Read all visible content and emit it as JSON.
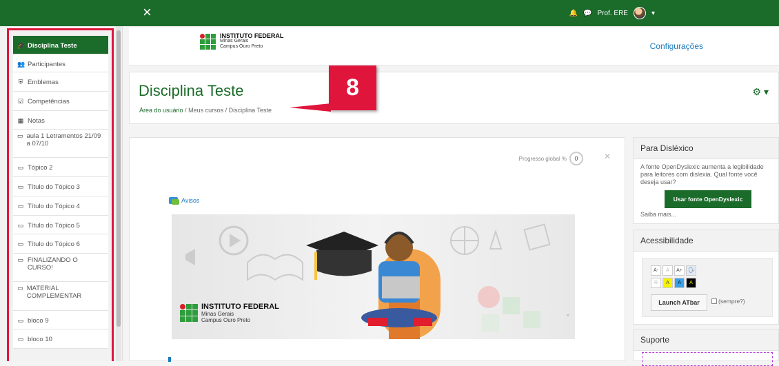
{
  "topbar": {
    "close_icon": "×",
    "user_name": "Prof. ERE"
  },
  "drawer": {
    "items": [
      {
        "label": "Disciplina Teste",
        "icon": "graduation-cap",
        "glyph": "🎓",
        "active": true
      },
      {
        "label": "Participantes",
        "icon": "users",
        "glyph": "👥"
      },
      {
        "label": "Emblemas",
        "icon": "shield",
        "glyph": "⛨"
      },
      {
        "label": "Competências",
        "icon": "check-square",
        "glyph": "☑"
      },
      {
        "label": "Notas",
        "icon": "table",
        "glyph": "▦"
      },
      {
        "label": "aula 1 Letramentos 21/09 a 07/10",
        "icon": "folder",
        "glyph": "▭"
      },
      {
        "label": "Tópico 2",
        "icon": "folder",
        "glyph": "▭"
      },
      {
        "label": "Título do Tópico 3",
        "icon": "folder",
        "glyph": "▭"
      },
      {
        "label": "Título do Tópico 4",
        "icon": "folder",
        "glyph": "▭"
      },
      {
        "label": "Título do Tópico 5",
        "icon": "folder",
        "glyph": "▭"
      },
      {
        "label": "Título do Tópico 6",
        "icon": "folder",
        "glyph": "▭"
      },
      {
        "label": "FINALIZANDO O CURSO!",
        "icon": "folder",
        "glyph": "▭"
      },
      {
        "label": "MATERIAL COMPLEMENTAR",
        "icon": "folder",
        "glyph": "▭"
      },
      {
        "label": "bloco 9",
        "icon": "folder",
        "glyph": "▭"
      },
      {
        "label": "bloco 10",
        "icon": "folder",
        "glyph": "▭"
      }
    ]
  },
  "header": {
    "logo_title": "INSTITUTO FEDERAL",
    "logo_line2": "Minas Gerais",
    "logo_line3": "Campus Ouro Preto",
    "config_link": "Configurações"
  },
  "page": {
    "title": "Disciplina Teste",
    "breadcrumb": [
      "Área do usuário",
      "Meus cursos",
      "Disciplina Teste"
    ],
    "annotation_number": "8"
  },
  "main": {
    "progress_label": "Progresso global %",
    "progress_value": "0",
    "avisos_label": "Avisos",
    "banner_logo_title": "INSTITUTO FEDERAL",
    "banner_logo_line2": "Minas Gerais",
    "banner_logo_line3": "Campus Ouro Preto"
  },
  "blocks": {
    "dyslexic": {
      "title": "Para Disléxico",
      "text": "A fonte OpenDyslexic aumenta a legibilidade para leitores com dislexia. Qual fonte você deseja usar?",
      "button": "Usar fonte OpenDyslexic",
      "more": "Saiba mais..."
    },
    "accessibility": {
      "title": "Acessibilidade",
      "row1": [
        "A-",
        "A",
        "A+"
      ],
      "row2": [
        "R",
        "A",
        "A",
        "A"
      ],
      "launch": "Launch ATbar",
      "always": "(sempre?)"
    },
    "support": {
      "title": "Suporte"
    }
  },
  "colors": {
    "brand_green": "#1b6b2a",
    "highlight_red": "#e0153c",
    "link_blue": "#1f7bbf"
  }
}
